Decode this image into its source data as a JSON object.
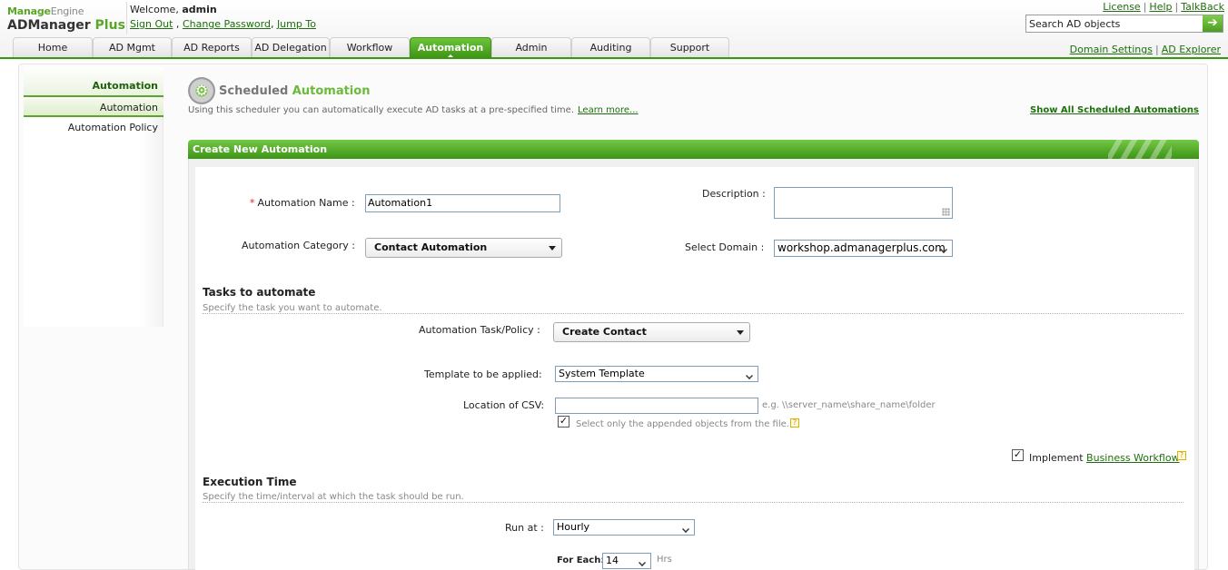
{
  "header": {
    "logo_vendor_a": "Manage",
    "logo_vendor_b": "Engine",
    "logo_product_a": "ADManager",
    "logo_product_b": " Plus",
    "welcome_label": "Welcome,",
    "username": "admin",
    "sign_out": "Sign Out",
    "change_password": "Change Password",
    "jump_to": "Jump To",
    "top_links": {
      "license": "License",
      "help": "Help",
      "talkback": "TalkBack"
    },
    "search_value": "Search AD objects",
    "domain_settings": "Domain Settings",
    "ad_explorer": "AD Explorer"
  },
  "tabs": [
    {
      "label": "Home"
    },
    {
      "label": "AD Mgmt"
    },
    {
      "label": "AD Reports"
    },
    {
      "label": "AD Delegation"
    },
    {
      "label": "Workflow"
    },
    {
      "label": "Automation"
    },
    {
      "label": "Admin"
    },
    {
      "label": "Auditing"
    },
    {
      "label": "Support"
    }
  ],
  "active_tab": "Automation",
  "sidebar": {
    "heading": "Automation",
    "items": [
      {
        "label": "Automation"
      },
      {
        "label": "Automation Policy"
      }
    ]
  },
  "page": {
    "title_a": "Scheduled",
    "title_b": " Automation",
    "subtitle": "Using this scheduler you can automatically execute AD tasks at a pre-specified time.",
    "learn_more": "Learn more...",
    "show_all": "Show All Scheduled Automations"
  },
  "form": {
    "header": "Create New Automation",
    "automation_name_label": "Automation Name :",
    "automation_name_value": "Automation1",
    "description_label": "Description :",
    "category_label": "Automation Category :",
    "category_value": "Contact Automation",
    "domain_label": "Select Domain :",
    "domain_value": "workshop.admanagerplus.com",
    "tasks_title": "Tasks to automate",
    "tasks_sub": "Specify the task you want to automate.",
    "task_policy_label": "Automation Task/Policy :",
    "task_policy_value": "Create Contact",
    "template_label": "Template to be applied:",
    "template_value": "System Template",
    "csv_label": "Location of CSV:",
    "csv_hint": "e.g. \\\\server_name\\share_name\\folder",
    "append_label": "Select only the appended objects from the file.",
    "implement_label": "Implement",
    "business_workflow": "Business Workflow",
    "execution_title": "Execution Time",
    "execution_sub": "Specify the time/interval at which the task should be run.",
    "run_at_label": "Run at :",
    "run_at_value": "Hourly",
    "for_each_label": "For Each:",
    "for_each_value": "14",
    "hrs_label": "Hrs"
  },
  "colors": {
    "brand_green": "#3e9414",
    "link_green": "#1f6e0e",
    "accent_green": "#6cb93b"
  }
}
